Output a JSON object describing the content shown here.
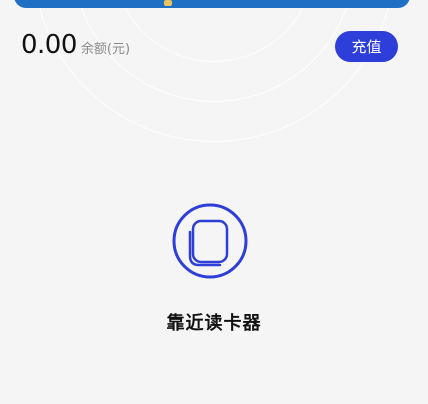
{
  "balance": {
    "amount": "0.00",
    "label": "余额(元)"
  },
  "actions": {
    "recharge_label": "充值"
  },
  "reader": {
    "hint": "靠近读卡器",
    "icon": "card-reader-icon"
  },
  "colors": {
    "accent": "#2e3ed8",
    "card_blue": "#1f6fc4",
    "background": "#f5f5f5"
  }
}
